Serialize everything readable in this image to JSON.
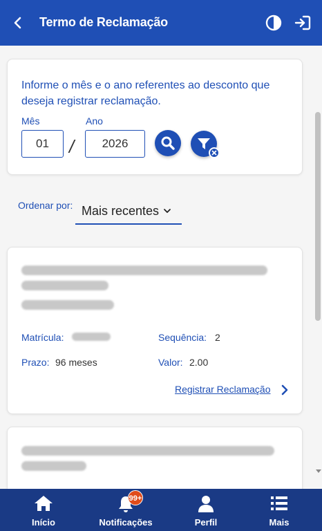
{
  "header": {
    "title": "Termo de Reclamação"
  },
  "filter": {
    "instruction": "Informe o mês e o ano referentes ao desconto que deseja registrar reclamação.",
    "month_label": "Mês",
    "month_value": "01",
    "year_label": "Ano",
    "year_value": "2026",
    "separator": "/"
  },
  "ordering": {
    "label": "Ordenar por:",
    "selected": "Mais recentes"
  },
  "items": [
    {
      "matricula_label": "Matrícula:",
      "sequencia_label": "Sequência:",
      "sequencia_value": "2",
      "prazo_label": "Prazo:",
      "prazo_value": "96 meses",
      "valor_label": "Valor:",
      "valor_value": "2.00",
      "action_label": "Registrar Reclamação"
    }
  ],
  "bottom_nav": {
    "items": [
      {
        "label": "Início",
        "icon": "home-icon"
      },
      {
        "label": "Notificações",
        "icon": "bell-icon"
      },
      {
        "label": "Perfil",
        "icon": "user-icon"
      },
      {
        "label": "Mais",
        "icon": "list-icon"
      }
    ],
    "notification_badge": "99+"
  },
  "colors": {
    "primary": "#1f4fb5",
    "nav_bg": "#1a3a85",
    "badge": "#e04b1a"
  }
}
